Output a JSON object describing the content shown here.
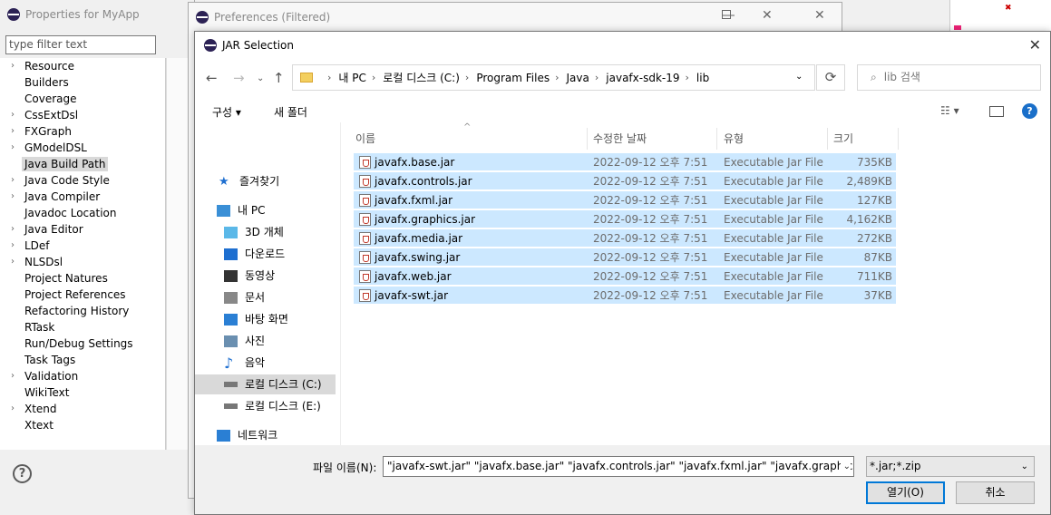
{
  "properties_window": {
    "title": "Properties for MyApp",
    "filter_placeholder": "type filter text",
    "tree": [
      {
        "label": "Resource",
        "expandable": true
      },
      {
        "label": "Builders",
        "expandable": false
      },
      {
        "label": "Coverage",
        "expandable": false
      },
      {
        "label": "CssExtDsl",
        "expandable": true
      },
      {
        "label": "FXGraph",
        "expandable": true
      },
      {
        "label": "GModelDSL",
        "expandable": true
      },
      {
        "label": "Java Build Path",
        "expandable": false,
        "selected": true
      },
      {
        "label": "Java Code Style",
        "expandable": true
      },
      {
        "label": "Java Compiler",
        "expandable": true
      },
      {
        "label": "Javadoc Location",
        "expandable": false
      },
      {
        "label": "Java Editor",
        "expandable": true
      },
      {
        "label": "LDef",
        "expandable": true
      },
      {
        "label": "NLSDsl",
        "expandable": true
      },
      {
        "label": "Project Natures",
        "expandable": false
      },
      {
        "label": "Project References",
        "expandable": false
      },
      {
        "label": "Refactoring History",
        "expandable": false
      },
      {
        "label": "RTask",
        "expandable": false
      },
      {
        "label": "Run/Debug Settings",
        "expandable": false
      },
      {
        "label": "Task Tags",
        "expandable": false
      },
      {
        "label": "Validation",
        "expandable": true
      },
      {
        "label": "WikiText",
        "expandable": false
      },
      {
        "label": "Xtend",
        "expandable": true
      },
      {
        "label": "Xtext",
        "expandable": false
      }
    ],
    "help_label": "?"
  },
  "preferences_window": {
    "title": "Preferences (Filtered)"
  },
  "jar_dialog": {
    "title": "JAR Selection",
    "address": [
      "내 PC",
      "로컬 디스크 (C:)",
      "Program Files",
      "Java",
      "javafx-sdk-19",
      "lib"
    ],
    "search_placeholder": "lib 검색",
    "organize_label": "구성 ▾",
    "new_folder_label": "새 폴더",
    "nav": [
      {
        "label": "즐겨찾기",
        "icon": "star-icon"
      },
      {
        "label": "내 PC",
        "icon": "pc-icon"
      },
      {
        "label": "3D 개체",
        "icon": "cube-icon"
      },
      {
        "label": "다운로드",
        "icon": "download-icon"
      },
      {
        "label": "동영상",
        "icon": "video-icon"
      },
      {
        "label": "문서",
        "icon": "document-icon"
      },
      {
        "label": "바탕 화면",
        "icon": "desktop-icon"
      },
      {
        "label": "사진",
        "icon": "picture-icon"
      },
      {
        "label": "음악",
        "icon": "music-icon"
      },
      {
        "label": "로컬 디스크 (C:)",
        "icon": "drive-icon",
        "selected": true
      },
      {
        "label": "로컬 디스크 (E:)",
        "icon": "drive-icon"
      },
      {
        "label": "네트워크",
        "icon": "network-icon"
      }
    ],
    "columns": {
      "name": "이름",
      "modified": "수정한 날짜",
      "type": "유형",
      "size": "크기"
    },
    "files": [
      {
        "name": "javafx.base.jar",
        "modified": "2022-09-12 오후 7:51",
        "type": "Executable Jar File",
        "size": "735KB"
      },
      {
        "name": "javafx.controls.jar",
        "modified": "2022-09-12 오후 7:51",
        "type": "Executable Jar File",
        "size": "2,489KB"
      },
      {
        "name": "javafx.fxml.jar",
        "modified": "2022-09-12 오후 7:51",
        "type": "Executable Jar File",
        "size": "127KB"
      },
      {
        "name": "javafx.graphics.jar",
        "modified": "2022-09-12 오후 7:51",
        "type": "Executable Jar File",
        "size": "4,162KB"
      },
      {
        "name": "javafx.media.jar",
        "modified": "2022-09-12 오후 7:51",
        "type": "Executable Jar File",
        "size": "272KB"
      },
      {
        "name": "javafx.swing.jar",
        "modified": "2022-09-12 오후 7:51",
        "type": "Executable Jar File",
        "size": "87KB"
      },
      {
        "name": "javafx.web.jar",
        "modified": "2022-09-12 오후 7:51",
        "type": "Executable Jar File",
        "size": "711KB"
      },
      {
        "name": "javafx-swt.jar",
        "modified": "2022-09-12 오후 7:51",
        "type": "Executable Jar File",
        "size": "37KB"
      }
    ],
    "filename_label": "파일 이름(N):",
    "filename_value": "\"javafx-swt.jar\" \"javafx.base.jar\" \"javafx.controls.jar\" \"javafx.fxml.jar\" \"javafx.graphics.jar\" \"jav",
    "filetype_value": "*.jar;*.zip",
    "open_label": "열기(O)",
    "cancel_label": "취소"
  },
  "colors": {
    "selection": "#cce8ff",
    "accent": "#0078d7"
  }
}
